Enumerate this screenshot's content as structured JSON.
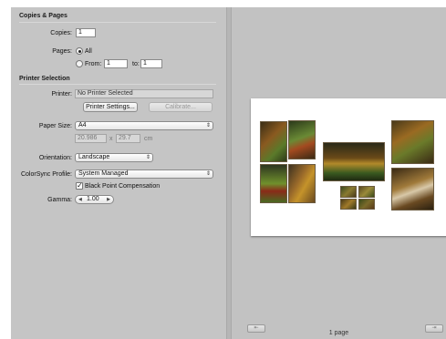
{
  "copies_pages": {
    "title": "Copies & Pages",
    "copies_label": "Copies:",
    "copies_value": "1",
    "pages_label": "Pages:",
    "all_label": "All",
    "from_label": "From:",
    "from_value": "1",
    "to_label": "to:",
    "to_value": "1"
  },
  "printer_selection": {
    "title": "Printer Selection",
    "printer_label": "Printer:",
    "printer_value": "No Printer Selected",
    "settings_button": "Printer Settings...",
    "calibrate_button": "Calibrate...",
    "paper_size_label": "Paper Size:",
    "paper_size_value": "A4",
    "width_value": "20.986",
    "times": "x",
    "height_value": "29.7",
    "unit": "cm",
    "orientation_label": "Orientation:",
    "orientation_value": "Landscape",
    "colorsync_label": "ColorSync Profile:",
    "colorsync_value": "System Managed",
    "bpc_label": "Black Point Compensation",
    "gamma_label": "Gamma:",
    "gamma_value": "1.00"
  },
  "preview": {
    "page_count": "1 page",
    "prev_icon": "arrow-left-icon",
    "next_icon": "arrow-right-icon"
  },
  "icons": {
    "popup": "chevron-updown-icon",
    "checkbox": "checkmark-icon"
  }
}
